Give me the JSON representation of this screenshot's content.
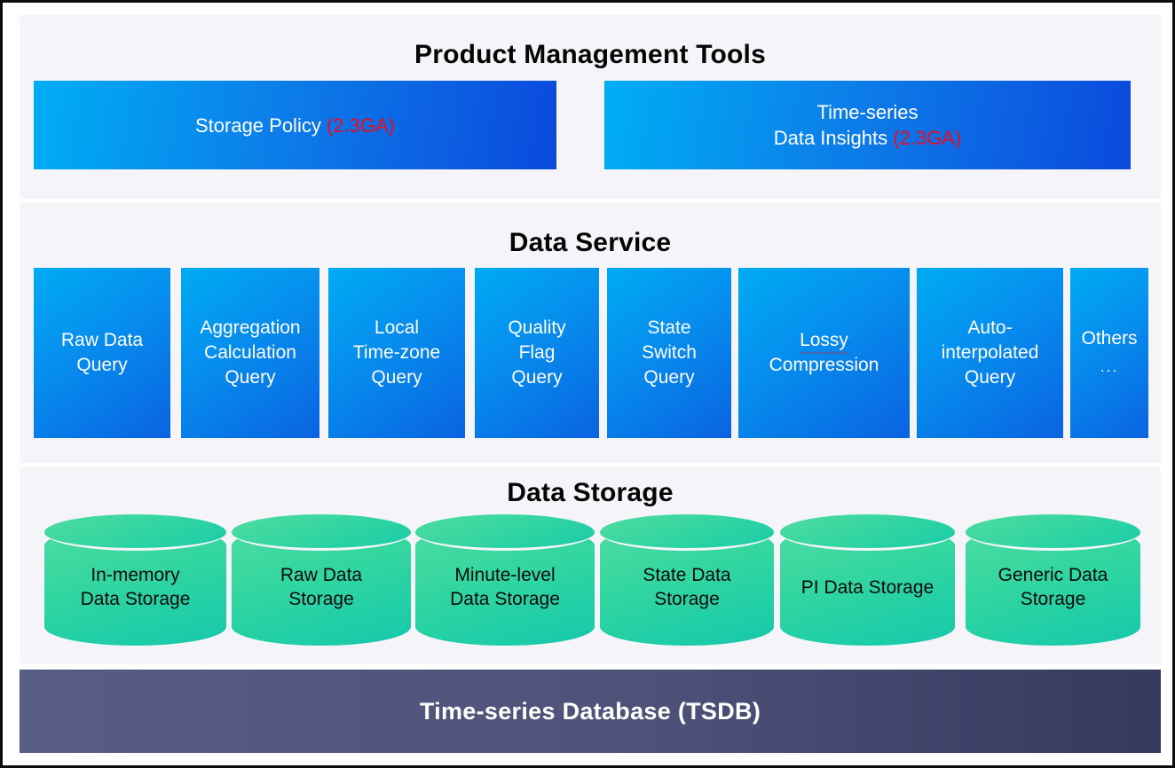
{
  "diagram": {
    "sections": {
      "product_management_tools": {
        "title": "Product Management Tools",
        "cards": [
          {
            "line1": "Storage Policy",
            "badge": "(2.3GA)",
            "line2": ""
          },
          {
            "line1": "Time-series",
            "line2": "Data Insights",
            "badge": "(2.3GA)"
          }
        ]
      },
      "data_service": {
        "title": "Data Service",
        "cards": [
          {
            "lines": [
              "Raw Data",
              "Query"
            ],
            "sub": ""
          },
          {
            "lines": [
              "Aggregation",
              "Calculation",
              "Query"
            ],
            "sub": ""
          },
          {
            "lines": [
              "Local",
              "Time-zone",
              "Query"
            ],
            "sub": ""
          },
          {
            "lines": [
              "Quality",
              "Flag",
              "Query"
            ],
            "sub": ""
          },
          {
            "lines": [
              "State",
              "Switch",
              "Query"
            ],
            "sub": ""
          },
          {
            "lines": [
              "Lossy",
              "Compression"
            ],
            "sub": "",
            "misspelled_word": "Lossy"
          },
          {
            "lines": [
              "Auto-",
              "interpolated",
              "Query"
            ],
            "sub": ""
          },
          {
            "lines": [
              "Others"
            ],
            "sub": "..."
          }
        ]
      },
      "data_storage": {
        "title": "Data Storage",
        "cylinders": [
          {
            "lines": [
              "In-memory",
              "Data Storage"
            ]
          },
          {
            "lines": [
              "Raw Data",
              "Storage"
            ]
          },
          {
            "lines": [
              "Minute-level",
              "Data Storage"
            ]
          },
          {
            "lines": [
              "State Data",
              "Storage"
            ]
          },
          {
            "lines": [
              "PI Data Storage"
            ]
          },
          {
            "lines": [
              "Generic Data",
              "Storage"
            ]
          }
        ]
      },
      "footer": {
        "title": "Time-series Database (TSDB)"
      }
    },
    "colors": {
      "card_blue_light": "#00abf3",
      "card_blue_dark": "#0a63e1",
      "badge_red": "#ee0a1e",
      "cylinder_green_light": "#4fdc9f",
      "cylinder_green_dark": "#15c8ab",
      "footer_slate": "#4e5178",
      "panel_background": "#f4f4f9",
      "page_background": "#ffffff",
      "border": "#0d0d0d"
    }
  }
}
